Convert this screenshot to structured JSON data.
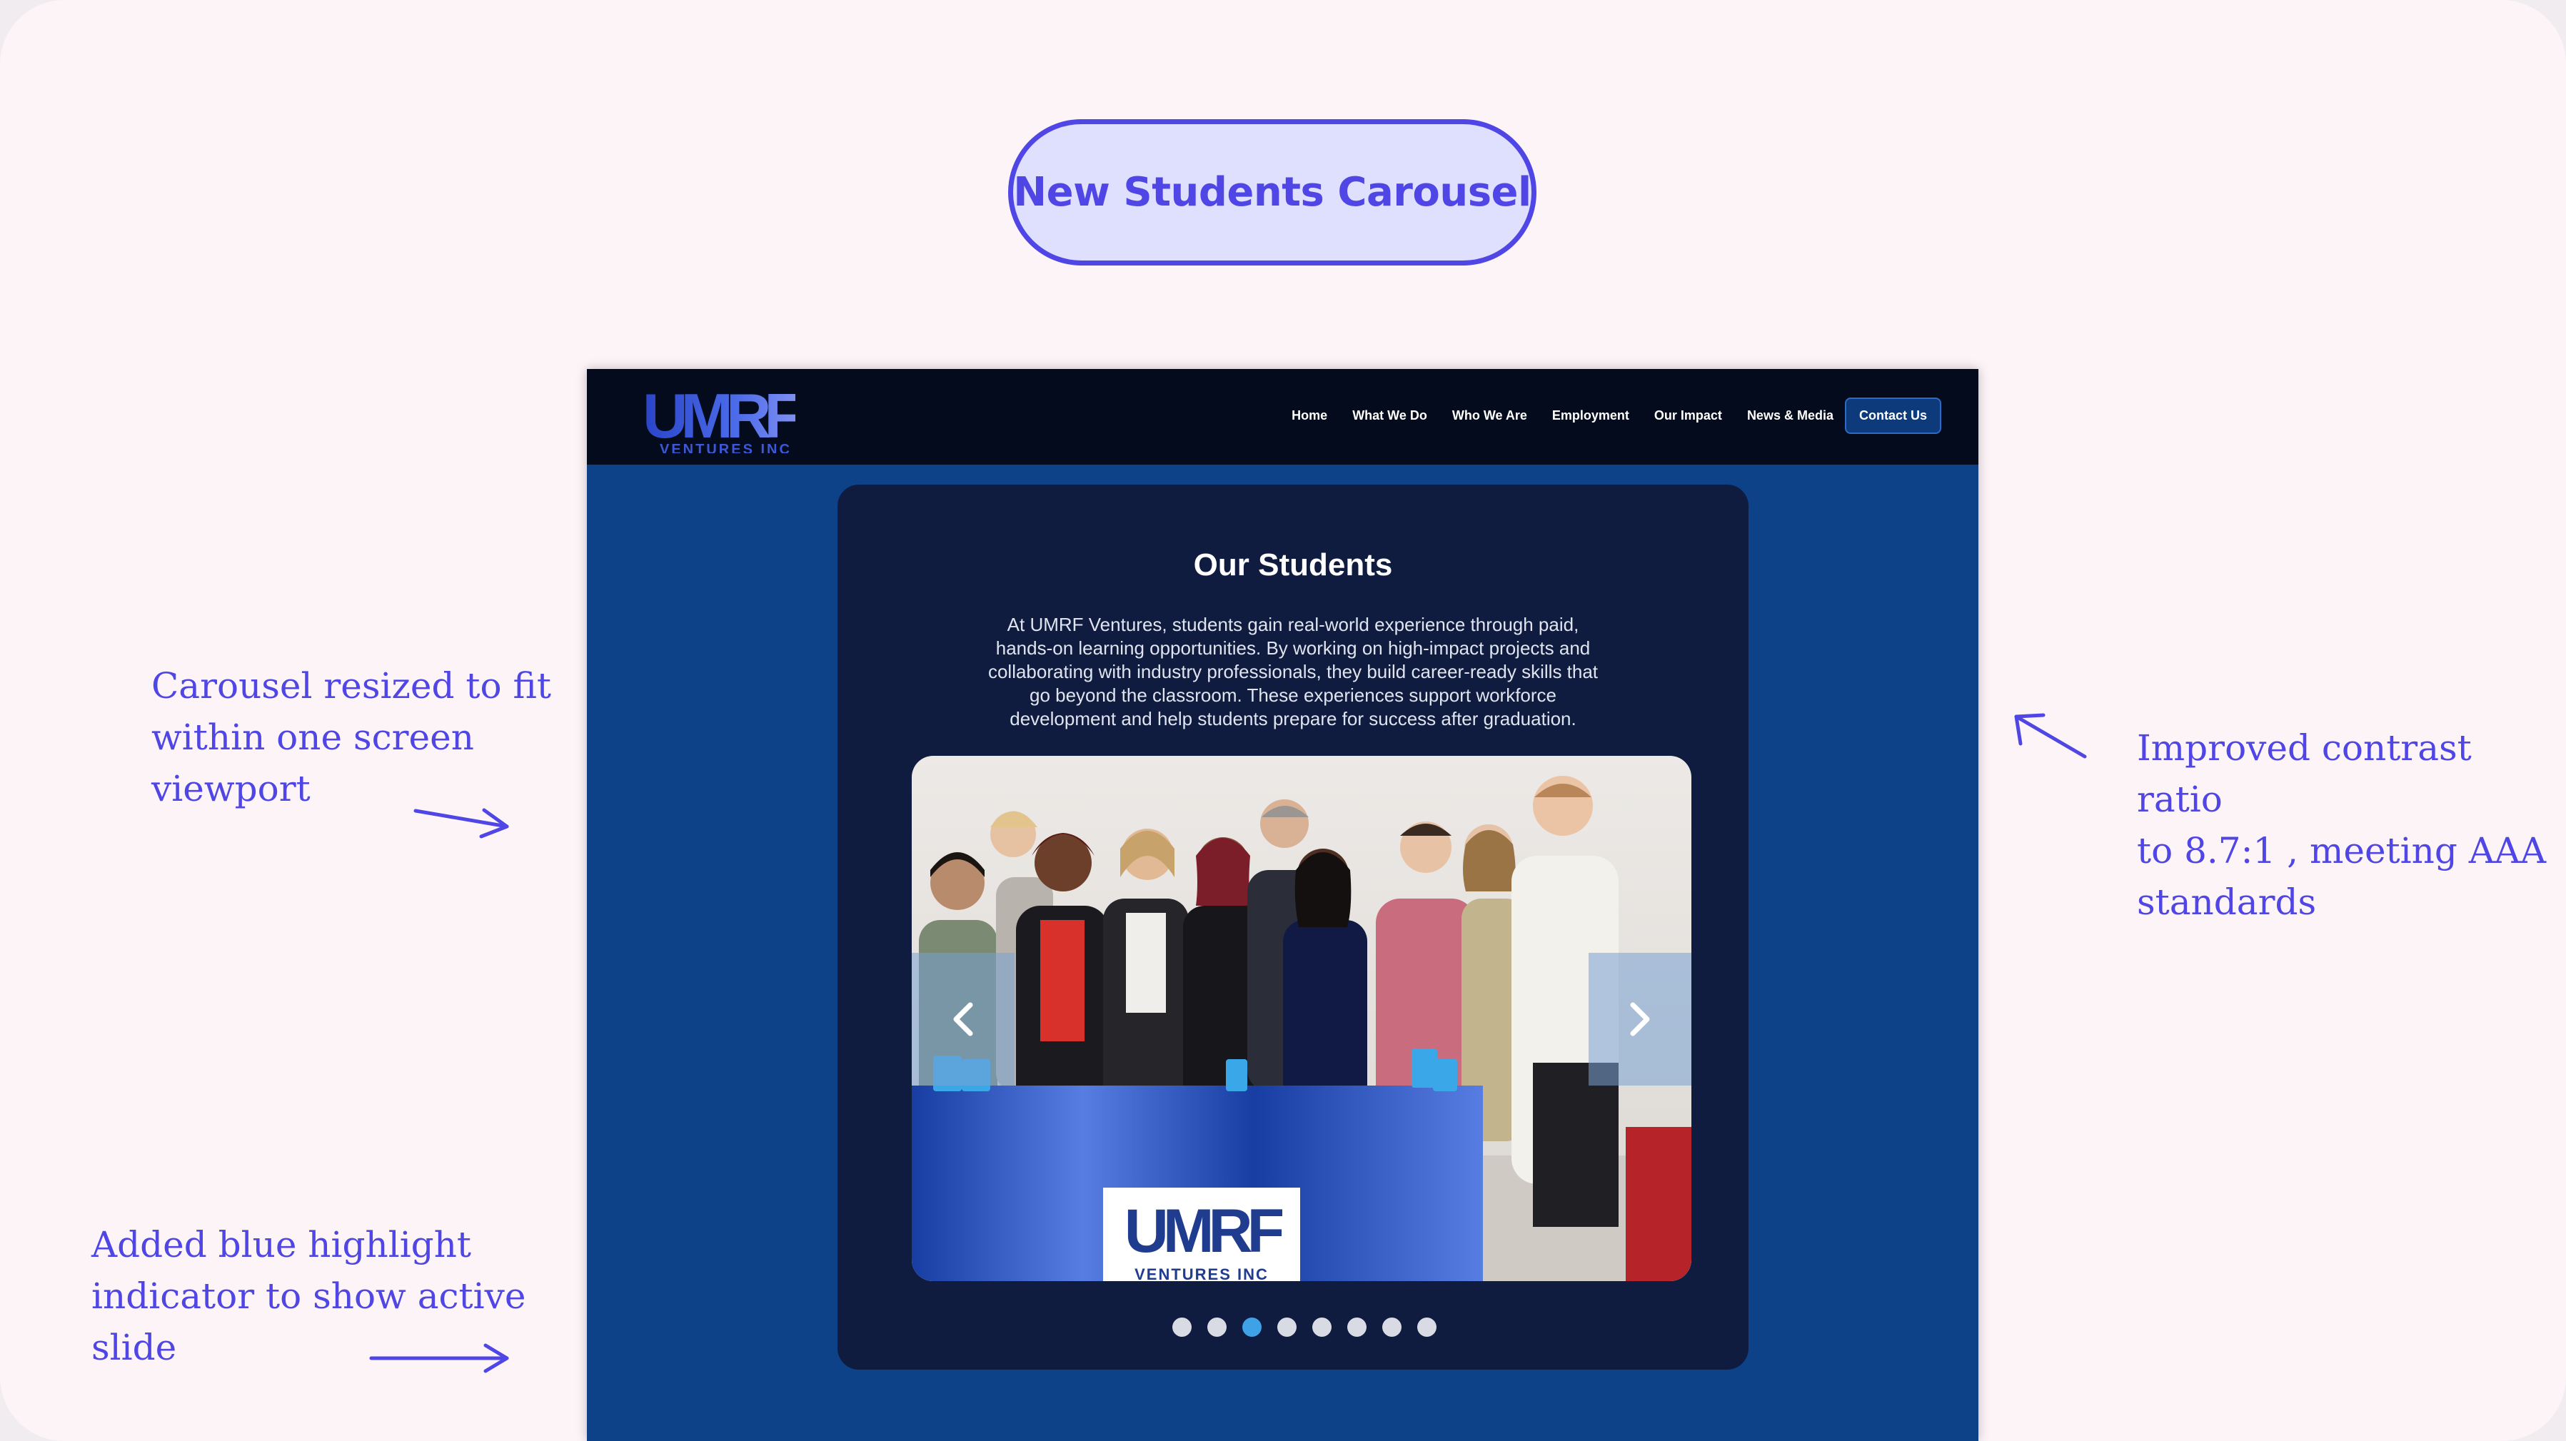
{
  "heading": "New Students Carousel",
  "annotations": {
    "left_top": [
      "Carousel resized to fit",
      "within one  screen",
      "viewport"
    ],
    "left_bottom": [
      "Added blue highlight",
      "indicator to show active",
      "slide"
    ],
    "right": [
      "Improved contrast ratio",
      "to 8.7:1 ,  meeting AAA",
      "standards"
    ]
  },
  "site": {
    "logo": {
      "main": "UMRF",
      "sub": "VENTURES INC"
    },
    "nav": {
      "items": [
        "Home",
        "What We Do",
        "Who We Are",
        "Employment",
        "Our Impact",
        "News & Media"
      ],
      "cta": "Contact Us"
    },
    "students": {
      "title": "Our Students",
      "body_lines": [
        "At UMRF Ventures, students gain real-world experience through paid,",
        "hands-on learning opportunities. By working on high-impact projects and",
        "collaborating with industry professionals, they build career-ready skills that",
        "go beyond the classroom. These experiences support workforce",
        "development and help students prepare for success after graduation."
      ],
      "banner_text": {
        "main": "UMRF",
        "sub": "VENTURES INC"
      },
      "slide_count": 8,
      "active_slide": 3
    }
  },
  "colors": {
    "accent": "#4f46e5",
    "page_bg": "#fdf4f8",
    "site_bg": "#0d4188",
    "card_bg": "#0f1b3f",
    "active_dot": "#3fa1e6"
  }
}
